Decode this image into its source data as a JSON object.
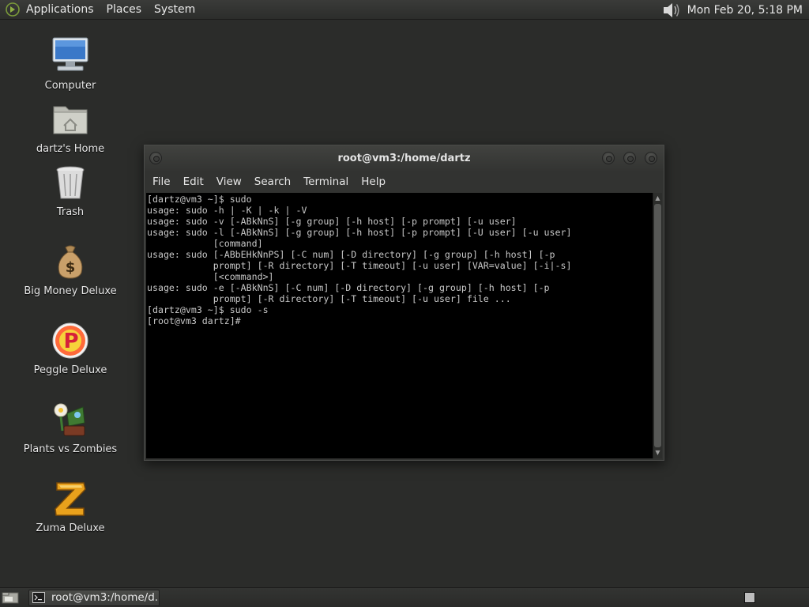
{
  "top_panel": {
    "menus": [
      "Applications",
      "Places",
      "System"
    ],
    "clock": "Mon Feb 20,  5:18 PM",
    "icons": {
      "logo": "gnome-foot-icon",
      "volume": "volume-icon"
    }
  },
  "desktop": {
    "icons": [
      {
        "label": "Computer",
        "icon": "computer-icon"
      },
      {
        "label": "dartz's Home",
        "icon": "home-folder-icon"
      },
      {
        "label": "Trash",
        "icon": "trash-icon"
      },
      {
        "label": "Big Money Deluxe",
        "icon": "money-bag-icon"
      },
      {
        "label": "Peggle Deluxe",
        "icon": "peggle-icon"
      },
      {
        "label": "Plants vs Zombies",
        "icon": "plants-vs-zombies-icon"
      },
      {
        "label": "Zuma Deluxe",
        "icon": "zuma-icon"
      }
    ]
  },
  "terminal": {
    "title": "root@vm3:/home/dartz",
    "menu": [
      "File",
      "Edit",
      "View",
      "Search",
      "Terminal",
      "Help"
    ],
    "lines": [
      "[dartz@vm3 ~]$ sudo",
      "usage: sudo -h | -K | -k | -V",
      "usage: sudo -v [-ABkNnS] [-g group] [-h host] [-p prompt] [-u user]",
      "usage: sudo -l [-ABkNnS] [-g group] [-h host] [-p prompt] [-U user] [-u user]",
      "            [command]",
      "usage: sudo [-ABbEHkNnPS] [-C num] [-D directory] [-g group] [-h host] [-p",
      "            prompt] [-R directory] [-T timeout] [-u user] [VAR=value] [-i|-s]",
      "            [<command>]",
      "usage: sudo -e [-ABkNnS] [-C num] [-D directory] [-g group] [-h host] [-p",
      "            prompt] [-R directory] [-T timeout] [-u user] file ...",
      "[dartz@vm3 ~]$ sudo -s",
      "[root@vm3 dartz]#"
    ]
  },
  "taskbar": {
    "items": [
      {
        "label": "root@vm3:/home/d...",
        "icon": "terminal-icon"
      }
    ],
    "show_desktop_icon": "show-desktop-icon"
  },
  "colors": {
    "desktop_bg": "#2b2c2a",
    "terminal_bg": "#000000",
    "terminal_fg": "#c8c8c8"
  }
}
